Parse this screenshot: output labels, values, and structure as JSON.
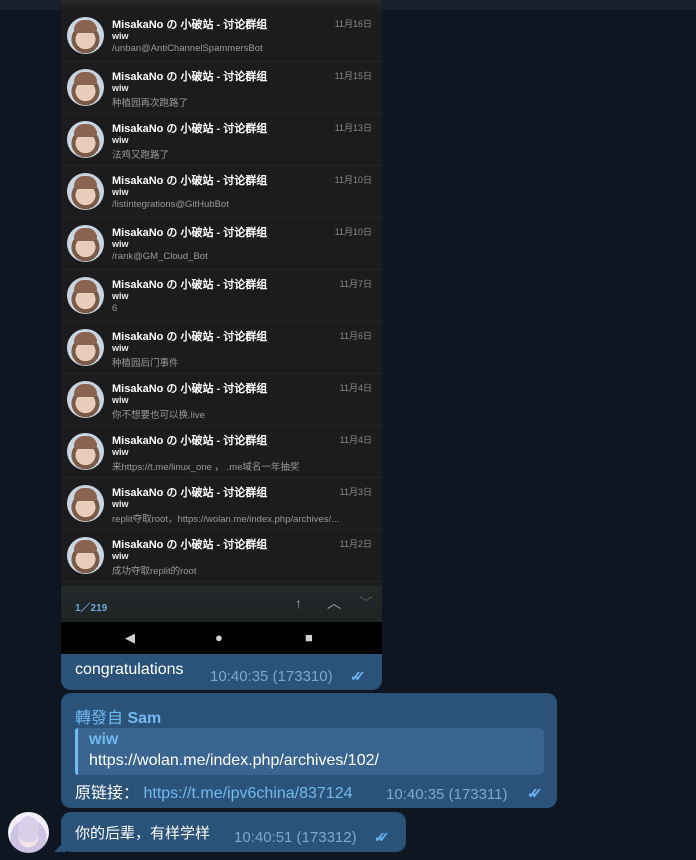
{
  "search_results": [
    {
      "chat": "MisakaNo の 小破站 - 讨论群组",
      "date": "11月16日",
      "from": "wiw",
      "text": "/unban@AntiChannelSpammersBot"
    },
    {
      "chat": "MisakaNo の 小破站 - 讨论群组",
      "date": "11月15日",
      "from": "wiw",
      "text": "种植园再次跑路了"
    },
    {
      "chat": "MisakaNo の 小破站 - 讨论群组",
      "date": "11月13日",
      "from": "wiw",
      "text": "法鸡又跑路了"
    },
    {
      "chat": "MisakaNo の 小破站 - 讨论群组",
      "date": "11月10日",
      "from": "wiw",
      "text": "/listintegrations@GitHubBot"
    },
    {
      "chat": "MisakaNo の 小破站 - 讨论群组",
      "date": "11月10日",
      "from": "wiw",
      "text": "/rank@GM_Cloud_Bot"
    },
    {
      "chat": "MisakaNo の 小破站 - 讨论群组",
      "date": "11月7日",
      "from": "wiw",
      "text": "6"
    },
    {
      "chat": "MisakaNo の 小破站 - 讨论群组",
      "date": "11月6日",
      "from": "wiw",
      "text": "种植园后门事件"
    },
    {
      "chat": "MisakaNo の 小破站 - 讨论群组",
      "date": "11月4日",
      "from": "wiw",
      "text": "你不想要也可以换.live"
    },
    {
      "chat": "MisakaNo の 小破站 - 讨论群组",
      "date": "11月4日",
      "from": "wiw",
      "text": "来https://t.me/linux_one ， .me域名一年抽奖"
    },
    {
      "chat": "MisakaNo の 小破站 - 讨论群组",
      "date": "11月3日",
      "from": "wiw",
      "text": "replit夺取root，https://wolan.me/index.php/archives/..."
    },
    {
      "chat": "MisakaNo の 小破站 - 讨论群组",
      "date": "11月2日",
      "from": "wiw",
      "text": "成功夺取replit的root"
    }
  ],
  "search_counter": "1／219",
  "icons": {
    "up": "arrow-up-icon",
    "prev": "chevron-up-icon",
    "next": "chevron-down-icon",
    "back": "android-back-icon",
    "home": "android-home-icon",
    "recents": "android-recents-icon",
    "read": "double-check-icon"
  },
  "messages": [
    {
      "text": "congratulations",
      "meta": "10:40:35 (173310)"
    },
    {
      "forward_prefix": "轉發自 ",
      "forward_from": "Sam",
      "quote_name": "wiw",
      "quote_text": "https://wolan.me/index.php/archives/102/",
      "orig_label": "原链接：",
      "orig_link": "https://t.me/ipv6china/837124",
      "meta": "10:40:35 (173311)"
    },
    {
      "text": "你的后辈，有样学样",
      "meta": "10:40:51 (173312)"
    }
  ],
  "colors": {
    "background": "#0e1621",
    "bubble": "#2b5278",
    "accent": "#71baf2",
    "meta": "#7da8d3"
  }
}
